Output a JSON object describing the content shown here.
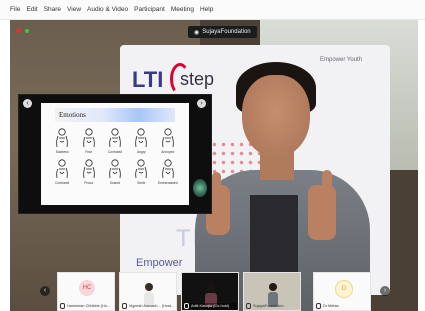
{
  "menu": [
    "File",
    "Edit",
    "Share",
    "View",
    "Audio & Video",
    "Participant",
    "Meeting",
    "Help"
  ],
  "host_badge": "SujayaFoundation",
  "banner": {
    "logo": "LTI",
    "step": "step",
    "tagline_top": "Empower Youth",
    "tl": "TL",
    "bottom": "Empower"
  },
  "shared_slide": {
    "title": "Emotions",
    "signs": [
      "Sadness",
      "Fear",
      "Confused",
      "Angry",
      "Annoyed",
      "Confused",
      "Proud",
      "Scared",
      "Smile",
      "Embarrassed"
    ]
  },
  "participants": [
    {
      "avatar": "HC",
      "name": "Harsimran Chhibbe (Ho...",
      "avatar_color": "#f6d6d6",
      "avatar_text_color": "#c44"
    },
    {
      "avatar": "",
      "name": "Vignesh Arunach... (Host...",
      "video": true
    },
    {
      "avatar": "",
      "name": "Aditi Kanojia (Co-host)",
      "video": true
    },
    {
      "avatar": "",
      "name": "SujayaFoundation",
      "video": true
    },
    {
      "avatar": "D",
      "name": "Dr Mehta",
      "avatar_color": "#fff4d1",
      "avatar_text_color": "#c9a23a"
    }
  ],
  "icons": [
    "recording-icon",
    "status-icon",
    "close-share-icon",
    "minimize-share-icon",
    "prev-page-icon",
    "next-page-icon",
    "mic-icon"
  ]
}
